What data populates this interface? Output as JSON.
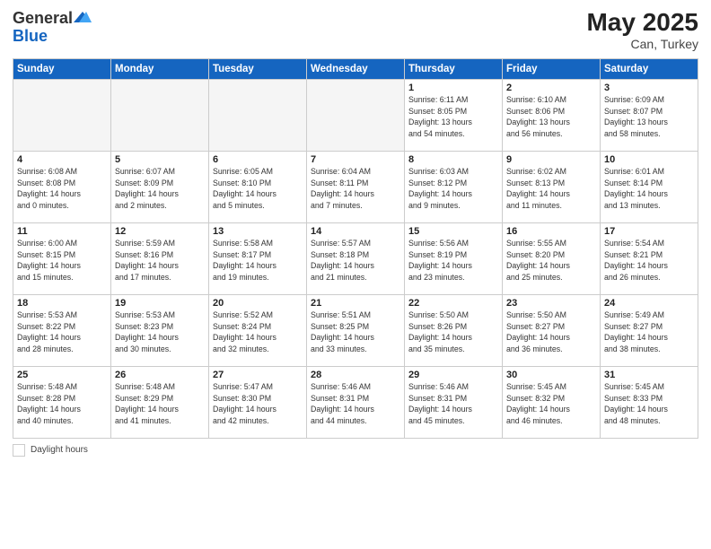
{
  "header": {
    "logo_general": "General",
    "logo_blue": "Blue",
    "month_year": "May 2025",
    "location": "Can, Turkey"
  },
  "footer": {
    "daylight_label": "Daylight hours"
  },
  "weekdays": [
    "Sunday",
    "Monday",
    "Tuesday",
    "Wednesday",
    "Thursday",
    "Friday",
    "Saturday"
  ],
  "weeks": [
    [
      {
        "day": "",
        "info": ""
      },
      {
        "day": "",
        "info": ""
      },
      {
        "day": "",
        "info": ""
      },
      {
        "day": "",
        "info": ""
      },
      {
        "day": "1",
        "info": "Sunrise: 6:11 AM\nSunset: 8:05 PM\nDaylight: 13 hours\nand 54 minutes."
      },
      {
        "day": "2",
        "info": "Sunrise: 6:10 AM\nSunset: 8:06 PM\nDaylight: 13 hours\nand 56 minutes."
      },
      {
        "day": "3",
        "info": "Sunrise: 6:09 AM\nSunset: 8:07 PM\nDaylight: 13 hours\nand 58 minutes."
      }
    ],
    [
      {
        "day": "4",
        "info": "Sunrise: 6:08 AM\nSunset: 8:08 PM\nDaylight: 14 hours\nand 0 minutes."
      },
      {
        "day": "5",
        "info": "Sunrise: 6:07 AM\nSunset: 8:09 PM\nDaylight: 14 hours\nand 2 minutes."
      },
      {
        "day": "6",
        "info": "Sunrise: 6:05 AM\nSunset: 8:10 PM\nDaylight: 14 hours\nand 5 minutes."
      },
      {
        "day": "7",
        "info": "Sunrise: 6:04 AM\nSunset: 8:11 PM\nDaylight: 14 hours\nand 7 minutes."
      },
      {
        "day": "8",
        "info": "Sunrise: 6:03 AM\nSunset: 8:12 PM\nDaylight: 14 hours\nand 9 minutes."
      },
      {
        "day": "9",
        "info": "Sunrise: 6:02 AM\nSunset: 8:13 PM\nDaylight: 14 hours\nand 11 minutes."
      },
      {
        "day": "10",
        "info": "Sunrise: 6:01 AM\nSunset: 8:14 PM\nDaylight: 14 hours\nand 13 minutes."
      }
    ],
    [
      {
        "day": "11",
        "info": "Sunrise: 6:00 AM\nSunset: 8:15 PM\nDaylight: 14 hours\nand 15 minutes."
      },
      {
        "day": "12",
        "info": "Sunrise: 5:59 AM\nSunset: 8:16 PM\nDaylight: 14 hours\nand 17 minutes."
      },
      {
        "day": "13",
        "info": "Sunrise: 5:58 AM\nSunset: 8:17 PM\nDaylight: 14 hours\nand 19 minutes."
      },
      {
        "day": "14",
        "info": "Sunrise: 5:57 AM\nSunset: 8:18 PM\nDaylight: 14 hours\nand 21 minutes."
      },
      {
        "day": "15",
        "info": "Sunrise: 5:56 AM\nSunset: 8:19 PM\nDaylight: 14 hours\nand 23 minutes."
      },
      {
        "day": "16",
        "info": "Sunrise: 5:55 AM\nSunset: 8:20 PM\nDaylight: 14 hours\nand 25 minutes."
      },
      {
        "day": "17",
        "info": "Sunrise: 5:54 AM\nSunset: 8:21 PM\nDaylight: 14 hours\nand 26 minutes."
      }
    ],
    [
      {
        "day": "18",
        "info": "Sunrise: 5:53 AM\nSunset: 8:22 PM\nDaylight: 14 hours\nand 28 minutes."
      },
      {
        "day": "19",
        "info": "Sunrise: 5:53 AM\nSunset: 8:23 PM\nDaylight: 14 hours\nand 30 minutes."
      },
      {
        "day": "20",
        "info": "Sunrise: 5:52 AM\nSunset: 8:24 PM\nDaylight: 14 hours\nand 32 minutes."
      },
      {
        "day": "21",
        "info": "Sunrise: 5:51 AM\nSunset: 8:25 PM\nDaylight: 14 hours\nand 33 minutes."
      },
      {
        "day": "22",
        "info": "Sunrise: 5:50 AM\nSunset: 8:26 PM\nDaylight: 14 hours\nand 35 minutes."
      },
      {
        "day": "23",
        "info": "Sunrise: 5:50 AM\nSunset: 8:27 PM\nDaylight: 14 hours\nand 36 minutes."
      },
      {
        "day": "24",
        "info": "Sunrise: 5:49 AM\nSunset: 8:27 PM\nDaylight: 14 hours\nand 38 minutes."
      }
    ],
    [
      {
        "day": "25",
        "info": "Sunrise: 5:48 AM\nSunset: 8:28 PM\nDaylight: 14 hours\nand 40 minutes."
      },
      {
        "day": "26",
        "info": "Sunrise: 5:48 AM\nSunset: 8:29 PM\nDaylight: 14 hours\nand 41 minutes."
      },
      {
        "day": "27",
        "info": "Sunrise: 5:47 AM\nSunset: 8:30 PM\nDaylight: 14 hours\nand 42 minutes."
      },
      {
        "day": "28",
        "info": "Sunrise: 5:46 AM\nSunset: 8:31 PM\nDaylight: 14 hours\nand 44 minutes."
      },
      {
        "day": "29",
        "info": "Sunrise: 5:46 AM\nSunset: 8:31 PM\nDaylight: 14 hours\nand 45 minutes."
      },
      {
        "day": "30",
        "info": "Sunrise: 5:45 AM\nSunset: 8:32 PM\nDaylight: 14 hours\nand 46 minutes."
      },
      {
        "day": "31",
        "info": "Sunrise: 5:45 AM\nSunset: 8:33 PM\nDaylight: 14 hours\nand 48 minutes."
      }
    ]
  ]
}
